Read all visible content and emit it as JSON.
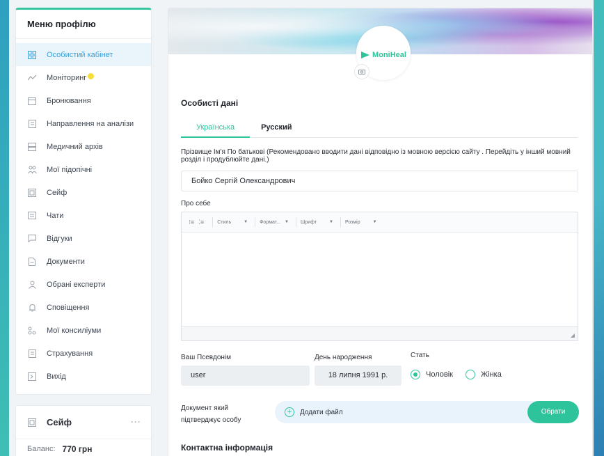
{
  "sidebar": {
    "title": "Меню профілю",
    "items": [
      {
        "label": "Особистий кабінет",
        "icon": "dashboard-icon"
      },
      {
        "label": "Моніторинг",
        "icon": "monitoring-icon"
      },
      {
        "label": "Бронювання",
        "icon": "calendar-icon"
      },
      {
        "label": "Направлення на аналізи",
        "icon": "clipboard-icon"
      },
      {
        "label": "Медичний архів",
        "icon": "archive-icon"
      },
      {
        "label": "Мої підопічні",
        "icon": "people-icon"
      },
      {
        "label": "Сейф",
        "icon": "safe-icon"
      },
      {
        "label": "Чати",
        "icon": "chat-icon"
      },
      {
        "label": "Відгуки",
        "icon": "review-icon"
      },
      {
        "label": "Документи",
        "icon": "document-icon"
      },
      {
        "label": "Обрані експерти",
        "icon": "user-icon"
      },
      {
        "label": "Сповіщення",
        "icon": "bell-icon"
      },
      {
        "label": "Мої консиліуми",
        "icon": "council-icon"
      },
      {
        "label": "Страхування",
        "icon": "insurance-icon"
      },
      {
        "label": "Вихід",
        "icon": "logout-icon"
      }
    ]
  },
  "safe_card": {
    "title": "Сейф",
    "more": "···",
    "balance_label": "Баланс:",
    "balance_value": "770 грн"
  },
  "brand": {
    "name": "MoniHeal",
    "accent": "#2ec49b"
  },
  "personal": {
    "title": "Особисті дані",
    "tabs": [
      "Українська",
      "Русский"
    ],
    "hint": "Прізвище Ім'я По батькові (Рекомендовано вводити дані відповідно із мовною версією сайту . Перейдіть у інший мовний розділ і продублюйте дані.)",
    "full_name": "Бойко Сергій Олександрович",
    "about_label": "Про себе",
    "toolbar": {
      "style": "Стиль",
      "format": "Формат...",
      "font": "Шрифт",
      "size": "Розмір"
    },
    "nickname_label": "Ваш Псевдонім",
    "nickname_value": "user",
    "birthday_label": "День народження",
    "birthday_value": "18 липня 1991 р.",
    "gender_label": "Стать",
    "gender_options": [
      "Чоловік",
      "Жінка"
    ],
    "gender_selected": "Чоловік",
    "doc_label_line1": "Документ який",
    "doc_label_line2": "підтверджує особу",
    "add_file": "Додати файл",
    "choose": "Обрати"
  },
  "contact": {
    "title": "Контактна інформація"
  }
}
